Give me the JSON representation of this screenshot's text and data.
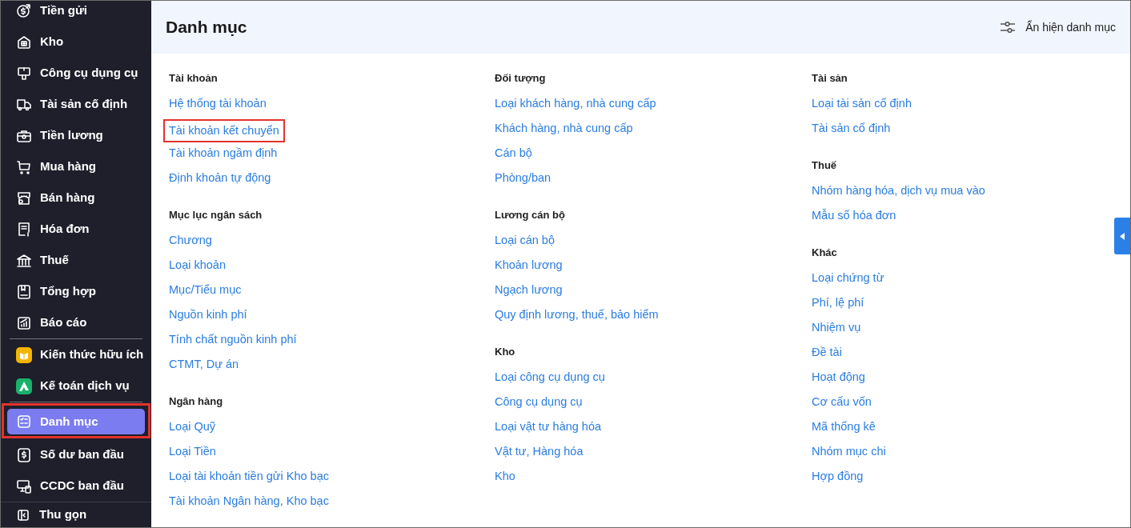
{
  "sidebar": {
    "groups": [
      [
        {
          "label": "Tiền gửi",
          "selected": false,
          "highlighted": false
        },
        {
          "label": "Kho",
          "selected": false,
          "highlighted": false
        },
        {
          "label": "Công cụ dụng cụ",
          "selected": false,
          "highlighted": false
        },
        {
          "label": "Tài sản cố định",
          "selected": false,
          "highlighted": false
        },
        {
          "label": "Tiền lương",
          "selected": false,
          "highlighted": false
        },
        {
          "label": "Mua hàng",
          "selected": false,
          "highlighted": false
        },
        {
          "label": "Bán hàng",
          "selected": false,
          "highlighted": false
        },
        {
          "label": "Hóa đơn",
          "selected": false,
          "highlighted": false
        },
        {
          "label": "Thuế",
          "selected": false,
          "highlighted": false
        },
        {
          "label": "Tổng hợp",
          "selected": false,
          "highlighted": false
        },
        {
          "label": "Báo cáo",
          "selected": false,
          "highlighted": false
        }
      ],
      [
        {
          "label": "Kiến thức hữu ích",
          "selected": false,
          "highlighted": false
        },
        {
          "label": "Kế toán dịch vụ",
          "selected": false,
          "highlighted": false
        }
      ],
      [
        {
          "label": "Danh mục",
          "selected": true,
          "highlighted": true
        },
        {
          "label": "Số dư ban đầu",
          "selected": false,
          "highlighted": false
        },
        {
          "label": "CCDC ban đầu",
          "selected": false,
          "highlighted": false
        }
      ]
    ],
    "collapse": "Thu gọn"
  },
  "header": {
    "title": "Danh mục",
    "action": "Ẩn hiện danh mục"
  },
  "columns": [
    [
      {
        "heading": "Tài khoản",
        "links": [
          {
            "label": "Hệ thống tài khoản",
            "highlighted": false
          },
          {
            "label": "Tài khoản kết chuyển",
            "highlighted": true
          },
          {
            "label": "Tài khoản ngầm định",
            "highlighted": false
          },
          {
            "label": "Định khoản tự động",
            "highlighted": false
          }
        ]
      },
      {
        "heading": "Mục lục ngân sách",
        "links": [
          {
            "label": "Chương",
            "highlighted": false
          },
          {
            "label": "Loại khoản",
            "highlighted": false
          },
          {
            "label": "Mục/Tiểu mục",
            "highlighted": false
          },
          {
            "label": "Nguồn kinh phí",
            "highlighted": false
          },
          {
            "label": "Tính chất nguồn kinh phí",
            "highlighted": false
          },
          {
            "label": "CTMT, Dự án",
            "highlighted": false
          }
        ]
      },
      {
        "heading": "Ngân hàng",
        "links": [
          {
            "label": "Loại Quỹ",
            "highlighted": false
          },
          {
            "label": "Loại Tiền",
            "highlighted": false
          },
          {
            "label": "Loại tài khoản tiền gửi Kho bạc",
            "highlighted": false
          },
          {
            "label": "Tài khoản Ngân hàng, Kho bạc",
            "highlighted": false
          }
        ]
      }
    ],
    [
      {
        "heading": "Đối tượng",
        "links": [
          {
            "label": "Loại khách hàng, nhà cung cấp",
            "highlighted": false
          },
          {
            "label": "Khách hàng, nhà cung cấp",
            "highlighted": false
          },
          {
            "label": "Cán bộ",
            "highlighted": false
          },
          {
            "label": "Phòng/ban",
            "highlighted": false
          }
        ]
      },
      {
        "heading": "Lương cán bộ",
        "links": [
          {
            "label": "Loại cán bộ",
            "highlighted": false
          },
          {
            "label": "Khoản lương",
            "highlighted": false
          },
          {
            "label": "Ngạch lương",
            "highlighted": false
          },
          {
            "label": "Quy định lương, thuế, bảo hiểm",
            "highlighted": false
          }
        ]
      },
      {
        "heading": "Kho",
        "links": [
          {
            "label": "Loại công cụ dụng cụ",
            "highlighted": false
          },
          {
            "label": "Công cụ dụng cụ",
            "highlighted": false
          },
          {
            "label": "Loại vật tư hàng hóa",
            "highlighted": false
          },
          {
            "label": "Vật tư, Hàng hóa",
            "highlighted": false
          },
          {
            "label": "Kho",
            "highlighted": false
          }
        ]
      }
    ],
    [
      {
        "heading": "Tài sản",
        "links": [
          {
            "label": "Loại tài sản cố định",
            "highlighted": false
          },
          {
            "label": "Tài sản cố định",
            "highlighted": false
          }
        ]
      },
      {
        "heading": "Thuế",
        "links": [
          {
            "label": "Nhóm hàng hóa, dịch vụ mua vào",
            "highlighted": false
          },
          {
            "label": "Mẫu số hóa đơn",
            "highlighted": false
          }
        ]
      },
      {
        "heading": "Khác",
        "links": [
          {
            "label": "Loại chứng từ",
            "highlighted": false
          },
          {
            "label": "Phí, lệ phí",
            "highlighted": false
          },
          {
            "label": "Nhiệm vụ",
            "highlighted": false
          },
          {
            "label": "Đề tài",
            "highlighted": false
          },
          {
            "label": "Hoạt động",
            "highlighted": false
          },
          {
            "label": "Cơ cấu vốn",
            "highlighted": false
          },
          {
            "label": "Mã thống kê",
            "highlighted": false
          },
          {
            "label": "Nhóm mục chi",
            "highlighted": false
          },
          {
            "label": "Hợp đồng",
            "highlighted": false
          }
        ]
      }
    ]
  ]
}
